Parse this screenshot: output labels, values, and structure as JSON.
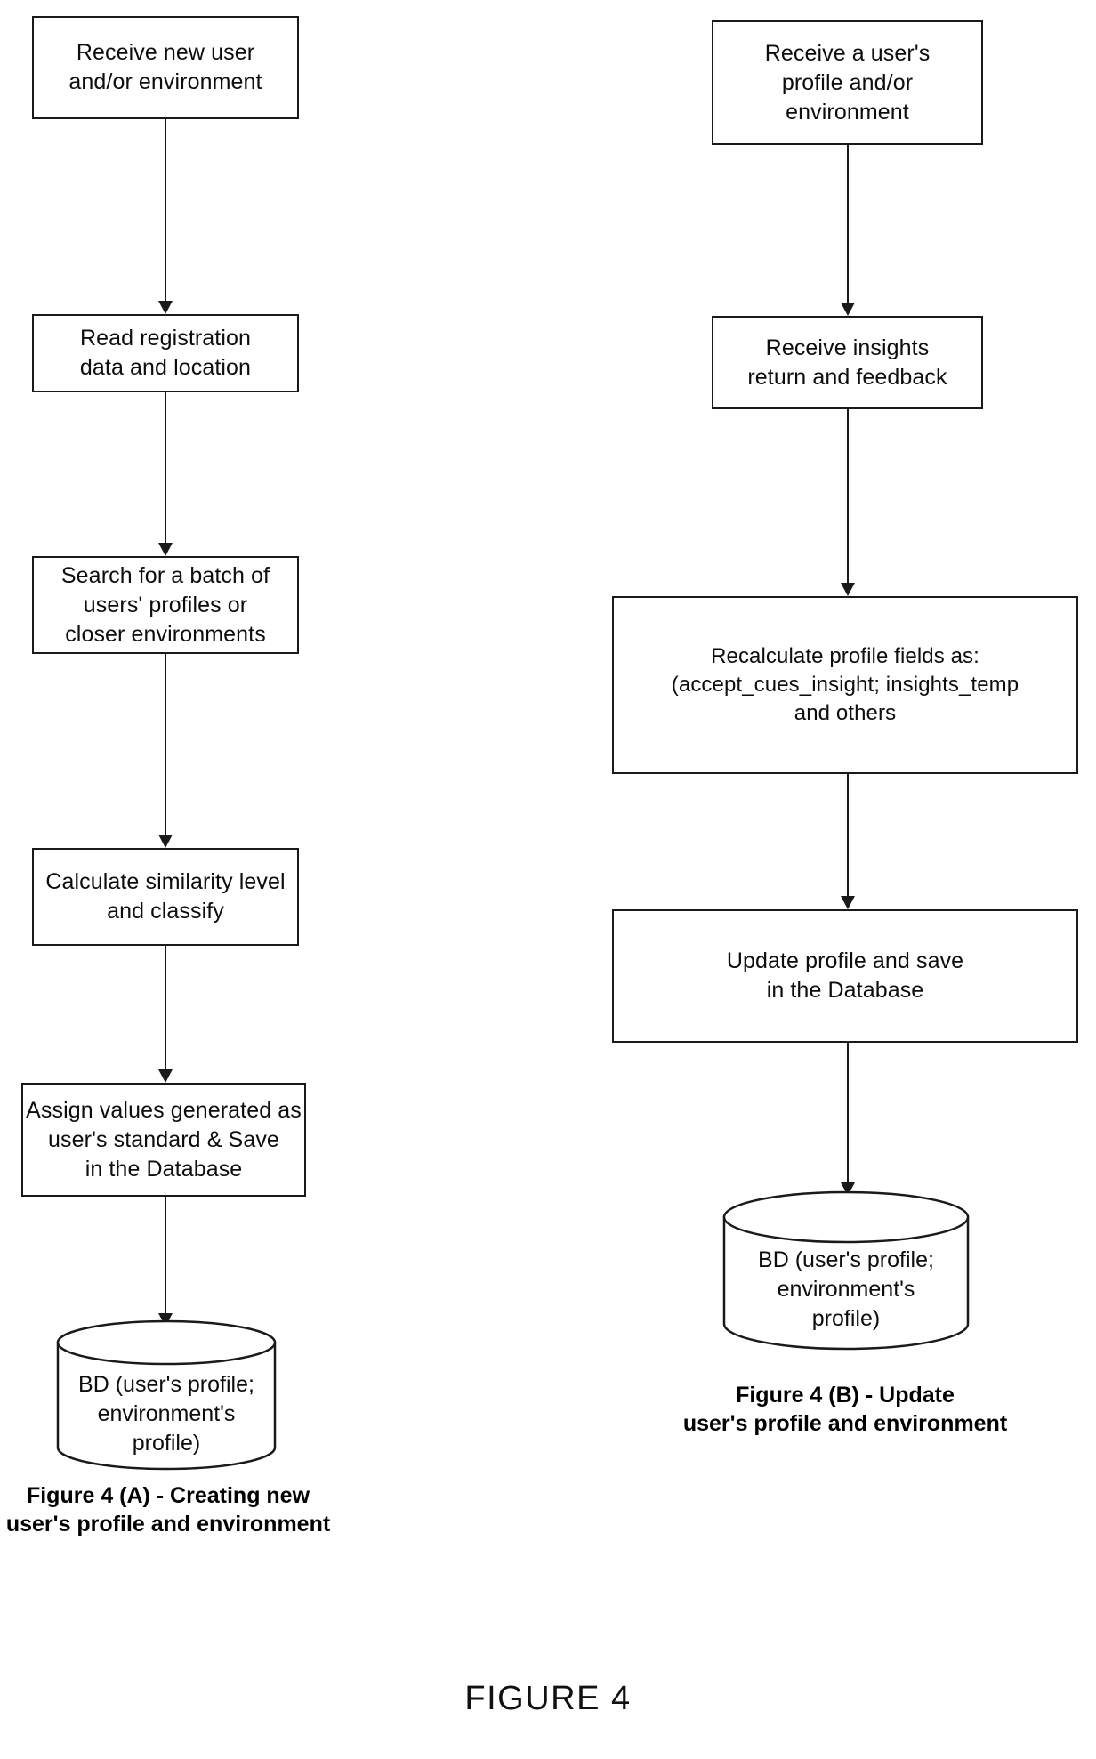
{
  "figure": {
    "title": "FIGURE 4"
  },
  "panel_a": {
    "caption": "Figure 4 (A) - Creating new\nuser's profile and environment",
    "nodes": [
      {
        "id": "a1",
        "label": "Receive new user\nand/or environment"
      },
      {
        "id": "a2",
        "label": "Read registration\ndata and location"
      },
      {
        "id": "a3",
        "label": "Search for a batch of\nusers' profiles or\ncloser environments"
      },
      {
        "id": "a4",
        "label": "Calculate similarity level\nand classify"
      },
      {
        "id": "a5",
        "label": "Assign values generated as\nuser's standard & Save\nin the Database"
      },
      {
        "id": "a6",
        "label": "BD (user's profile;\nenvironment's\nprofile)"
      }
    ]
  },
  "panel_b": {
    "caption": "Figure 4 (B) - Update\nuser's profile and environment",
    "nodes": [
      {
        "id": "b1",
        "label": "Receive a user's\nprofile and/or\nenvironment"
      },
      {
        "id": "b2",
        "label": "Receive insights\nreturn and feedback"
      },
      {
        "id": "b3",
        "label": "Recalculate profile fields as:\n(accept_cues_insight; insights_temp\nand others"
      },
      {
        "id": "b4",
        "label": "Update profile and save\nin the Database"
      },
      {
        "id": "b5",
        "label": "BD (user's profile;\nenvironment's\nprofile)"
      }
    ]
  },
  "colors": {
    "stroke": "#1a1a1a",
    "text": "#0d0d0d",
    "background": "#ffffff"
  }
}
